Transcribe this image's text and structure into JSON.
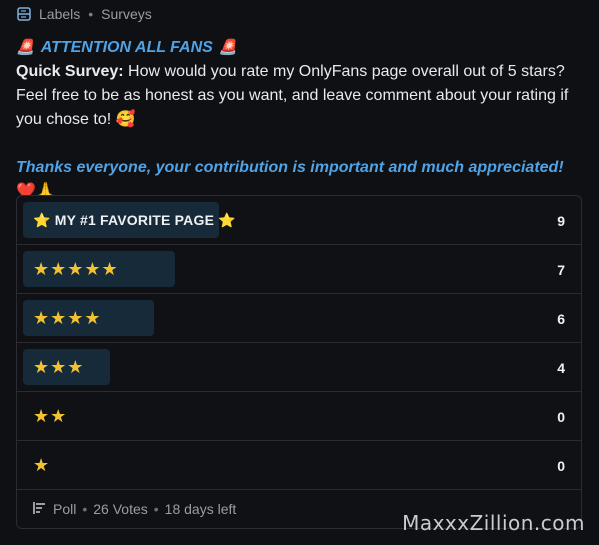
{
  "breadcrumb": {
    "section": "Labels",
    "separator": "•",
    "page": "Surveys"
  },
  "post": {
    "siren_emoji": "🚨",
    "attention": "ATTENTION ALL FANS",
    "quick_label": "Quick Survey:",
    "question": " How would you rate my OnlyFans page overall out of 5 stars? Feel free to be as honest as you want, and leave comment about your rating if you chose to! 🥰",
    "thanks": "Thanks everyone, your contribution is important and much appreciated!",
    "thanks_emojis": " ❤️🙏"
  },
  "poll": {
    "options": [
      {
        "label": "⭐ MY #1 FAVORITE PAGE ⭐",
        "stars": "",
        "votes": 9,
        "vote_text": "9",
        "share": 0.346
      },
      {
        "label": "",
        "stars": "★★★★★",
        "votes": 7,
        "vote_text": "7",
        "share": 0.269
      },
      {
        "label": "",
        "stars": "★★★★",
        "votes": 6,
        "vote_text": "6",
        "share": 0.231
      },
      {
        "label": "",
        "stars": "★★★",
        "votes": 4,
        "vote_text": "4",
        "share": 0.154
      },
      {
        "label": "",
        "stars": "★★",
        "votes": 0,
        "vote_text": "0",
        "share": 0
      },
      {
        "label": "",
        "stars": "★",
        "votes": 0,
        "vote_text": "0",
        "share": 0
      }
    ],
    "footer": {
      "type": "Poll",
      "votes": "26 Votes",
      "time_left": "18 days left",
      "separator": "•"
    }
  },
  "watermark": "MaxxxZillion.com",
  "colors": {
    "accent": "#4fa3e6",
    "bar": "#162a3a",
    "star": "#f2c230"
  }
}
